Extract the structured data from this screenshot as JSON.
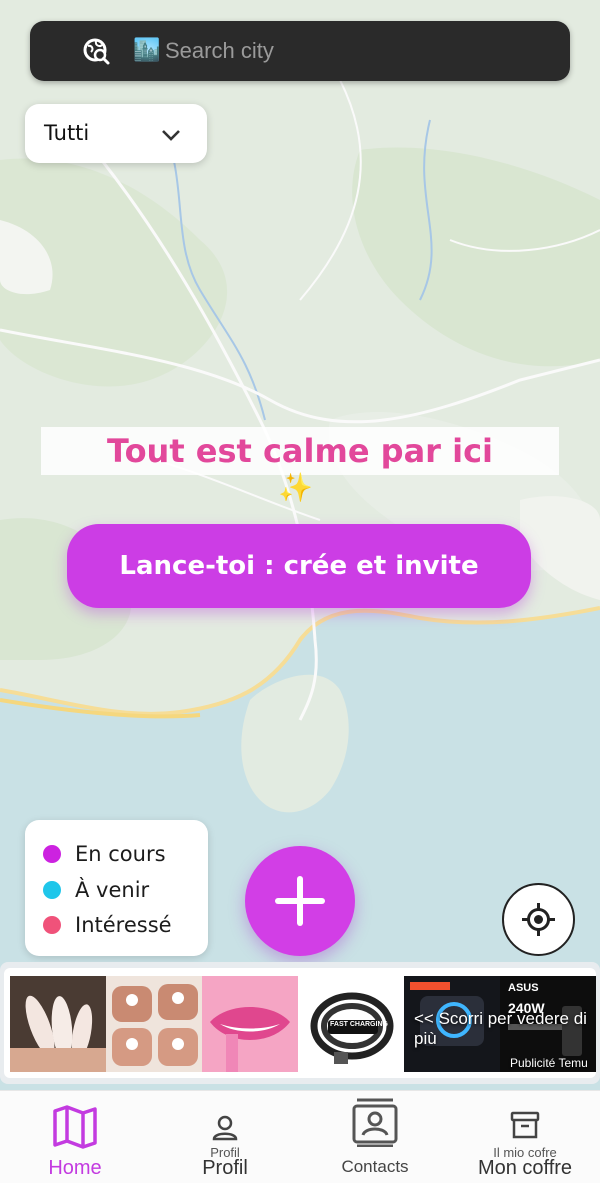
{
  "search": {
    "city_emoji": "🏙️",
    "placeholder": "Search city"
  },
  "filter": {
    "selected": "Tutti"
  },
  "empty_state": {
    "title": "Tout est calme par ici",
    "emoji": "✨",
    "cta_label": "Lance-toi : crée et invite"
  },
  "legend": {
    "items": [
      {
        "label": "En cours",
        "color": "#cc22e0"
      },
      {
        "label": "À venir",
        "color": "#1fc6ea"
      },
      {
        "label": "Intéressé",
        "color": "#f0527a"
      }
    ]
  },
  "ads": {
    "scroll_hint": "<< Scorri per vedere di più",
    "publicite": "Publicité Temu",
    "charger_text": "FAST CHARGING",
    "charger_watt": "240W",
    "asus_text": "ASUS"
  },
  "nav": {
    "items": [
      {
        "label": "Home",
        "hidden_label": ""
      },
      {
        "label": "Profil",
        "hidden_label": "Profil"
      },
      {
        "label": "Contacts",
        "hidden_label": ""
      },
      {
        "label": "Mon coffre",
        "hidden_label": "Il mio cofre"
      }
    ],
    "active_color": "#c33be0"
  }
}
